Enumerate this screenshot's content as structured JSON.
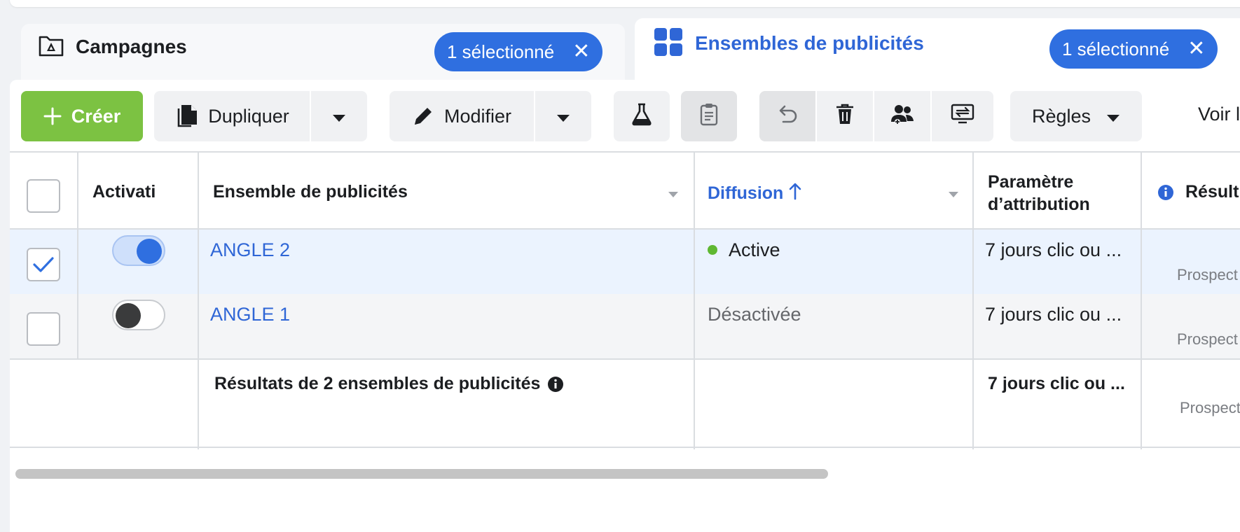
{
  "tabs": {
    "campaigns": {
      "title": "Campagnes",
      "selected_badge": "1 sélectionné"
    },
    "adsets": {
      "title": "Ensembles de publicités",
      "selected_badge": "1 sélectionné"
    }
  },
  "toolbar": {
    "create_label": "Créer",
    "duplicate_label": "Dupliquer",
    "edit_label": "Modifier",
    "rules_label": "Règles",
    "view_label": "Voir la"
  },
  "table": {
    "headers": {
      "activation": "Activati",
      "adset": "Ensemble de publicités",
      "delivery": "Diffusion",
      "attribution_line1": "Paramètre",
      "attribution_line2": "d’attribution",
      "results": "Résult"
    },
    "rows": [
      {
        "name": "ANGLE 2",
        "delivery": "Active",
        "attribution": "7 jours clic ou ...",
        "results_sub": "Prospect",
        "selected": true,
        "on": true
      },
      {
        "name": "ANGLE 1",
        "delivery": "Désactivée",
        "attribution": "7 jours clic ou ...",
        "results_sub": "Prospect",
        "selected": false,
        "on": false
      }
    ],
    "summary": {
      "label": "Résultats de 2 ensembles de publicités",
      "attribution": "7 jours clic ou ...",
      "results_sub": "Prospect"
    }
  },
  "colors": {
    "accent": "#2f6fe0",
    "create": "#7cc242",
    "active_dot": "#5fb832"
  }
}
